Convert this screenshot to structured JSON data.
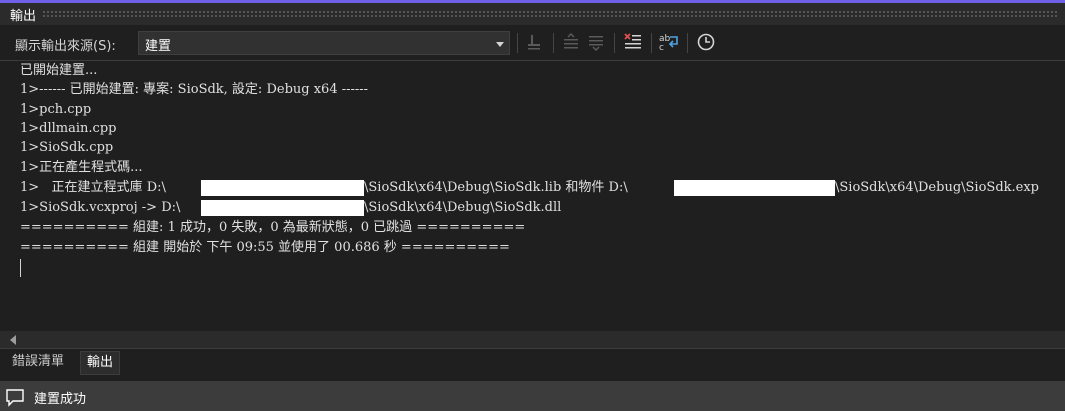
{
  "panel": {
    "title": "輸出"
  },
  "toolbar": {
    "source_label": "顯示輸出來源(S):",
    "source_value": "建置"
  },
  "output": {
    "lines": [
      "已開始建置...",
      "1>------ 已開始建置: 專案: SioSdk, 設定: Debug x64 ------",
      "1>pch.cpp",
      "1>dllmain.cpp",
      "1>SioSdk.cpp",
      "1>正在產生程式碼...",
      "1>   正在建立程式庫 D:\\",
      "1>SioSdk.vcxproj -> D:\\",
      "========== 組建: 1 成功，0 失敗，0 為最新狀態，0 已跳過 ==========",
      "========== 組建 開始於 下午 09:55 並使用了 00.686 秒 =========="
    ],
    "lib_path_tail": "\\SioSdk\\x64\\Debug\\SioSdk.lib 和物件 D:\\",
    "exp_path_tail": "\\SioSdk\\x64\\Debug\\SioSdk.exp",
    "dll_path_tail": "\\SioSdk\\x64\\Debug\\SioSdk.dll"
  },
  "tabs": [
    "錯誤清單",
    "輸出"
  ],
  "status": {
    "text": "建置成功"
  }
}
